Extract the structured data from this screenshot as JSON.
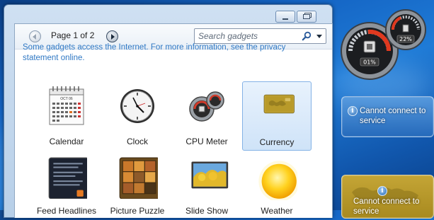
{
  "gallery": {
    "pager_label": "Page 1 of 2",
    "search_placeholder": "Search gadgets",
    "info_text": "Some gadgets access the Internet.  For more information, see the privacy statement online.",
    "gadgets": [
      {
        "label": "Calendar",
        "icon": "calendar-icon",
        "selected": false
      },
      {
        "label": "Clock",
        "icon": "clock-icon",
        "selected": false
      },
      {
        "label": "CPU Meter",
        "icon": "cpu-meter-icon",
        "selected": false
      },
      {
        "label": "Currency",
        "icon": "currency-icon",
        "selected": true
      },
      {
        "label": "Feed Headlines",
        "icon": "feed-headlines-icon",
        "selected": false
      },
      {
        "label": "Picture Puzzle",
        "icon": "picture-puzzle-icon",
        "selected": false
      },
      {
        "label": "Slide Show",
        "icon": "slide-show-icon",
        "selected": false
      },
      {
        "label": "Weather",
        "icon": "weather-icon",
        "selected": false
      }
    ],
    "calendar_month": "OCT 06"
  },
  "sidebar": {
    "cpu_meter": {
      "cpu_usage": "01%",
      "memory_usage": "22%"
    },
    "notices": [
      {
        "text": "Cannot connect to service"
      },
      {
        "text": "Cannot connect to service"
      }
    ]
  },
  "colors": {
    "info_link": "#2f78c4",
    "selection_fill": "#cfe3f8",
    "currency_card": "#b09322"
  }
}
